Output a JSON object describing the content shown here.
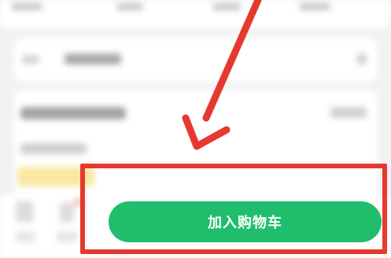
{
  "product_page": {
    "add_to_cart_label": "加入购物车"
  },
  "annotation": {
    "highlight_color": "#e5392f",
    "arrow_color": "#e5392f",
    "target": "add-to-cart-button"
  },
  "colors": {
    "primary_button": "#20bd6c",
    "coupon_tag": "#f9e8a3"
  }
}
